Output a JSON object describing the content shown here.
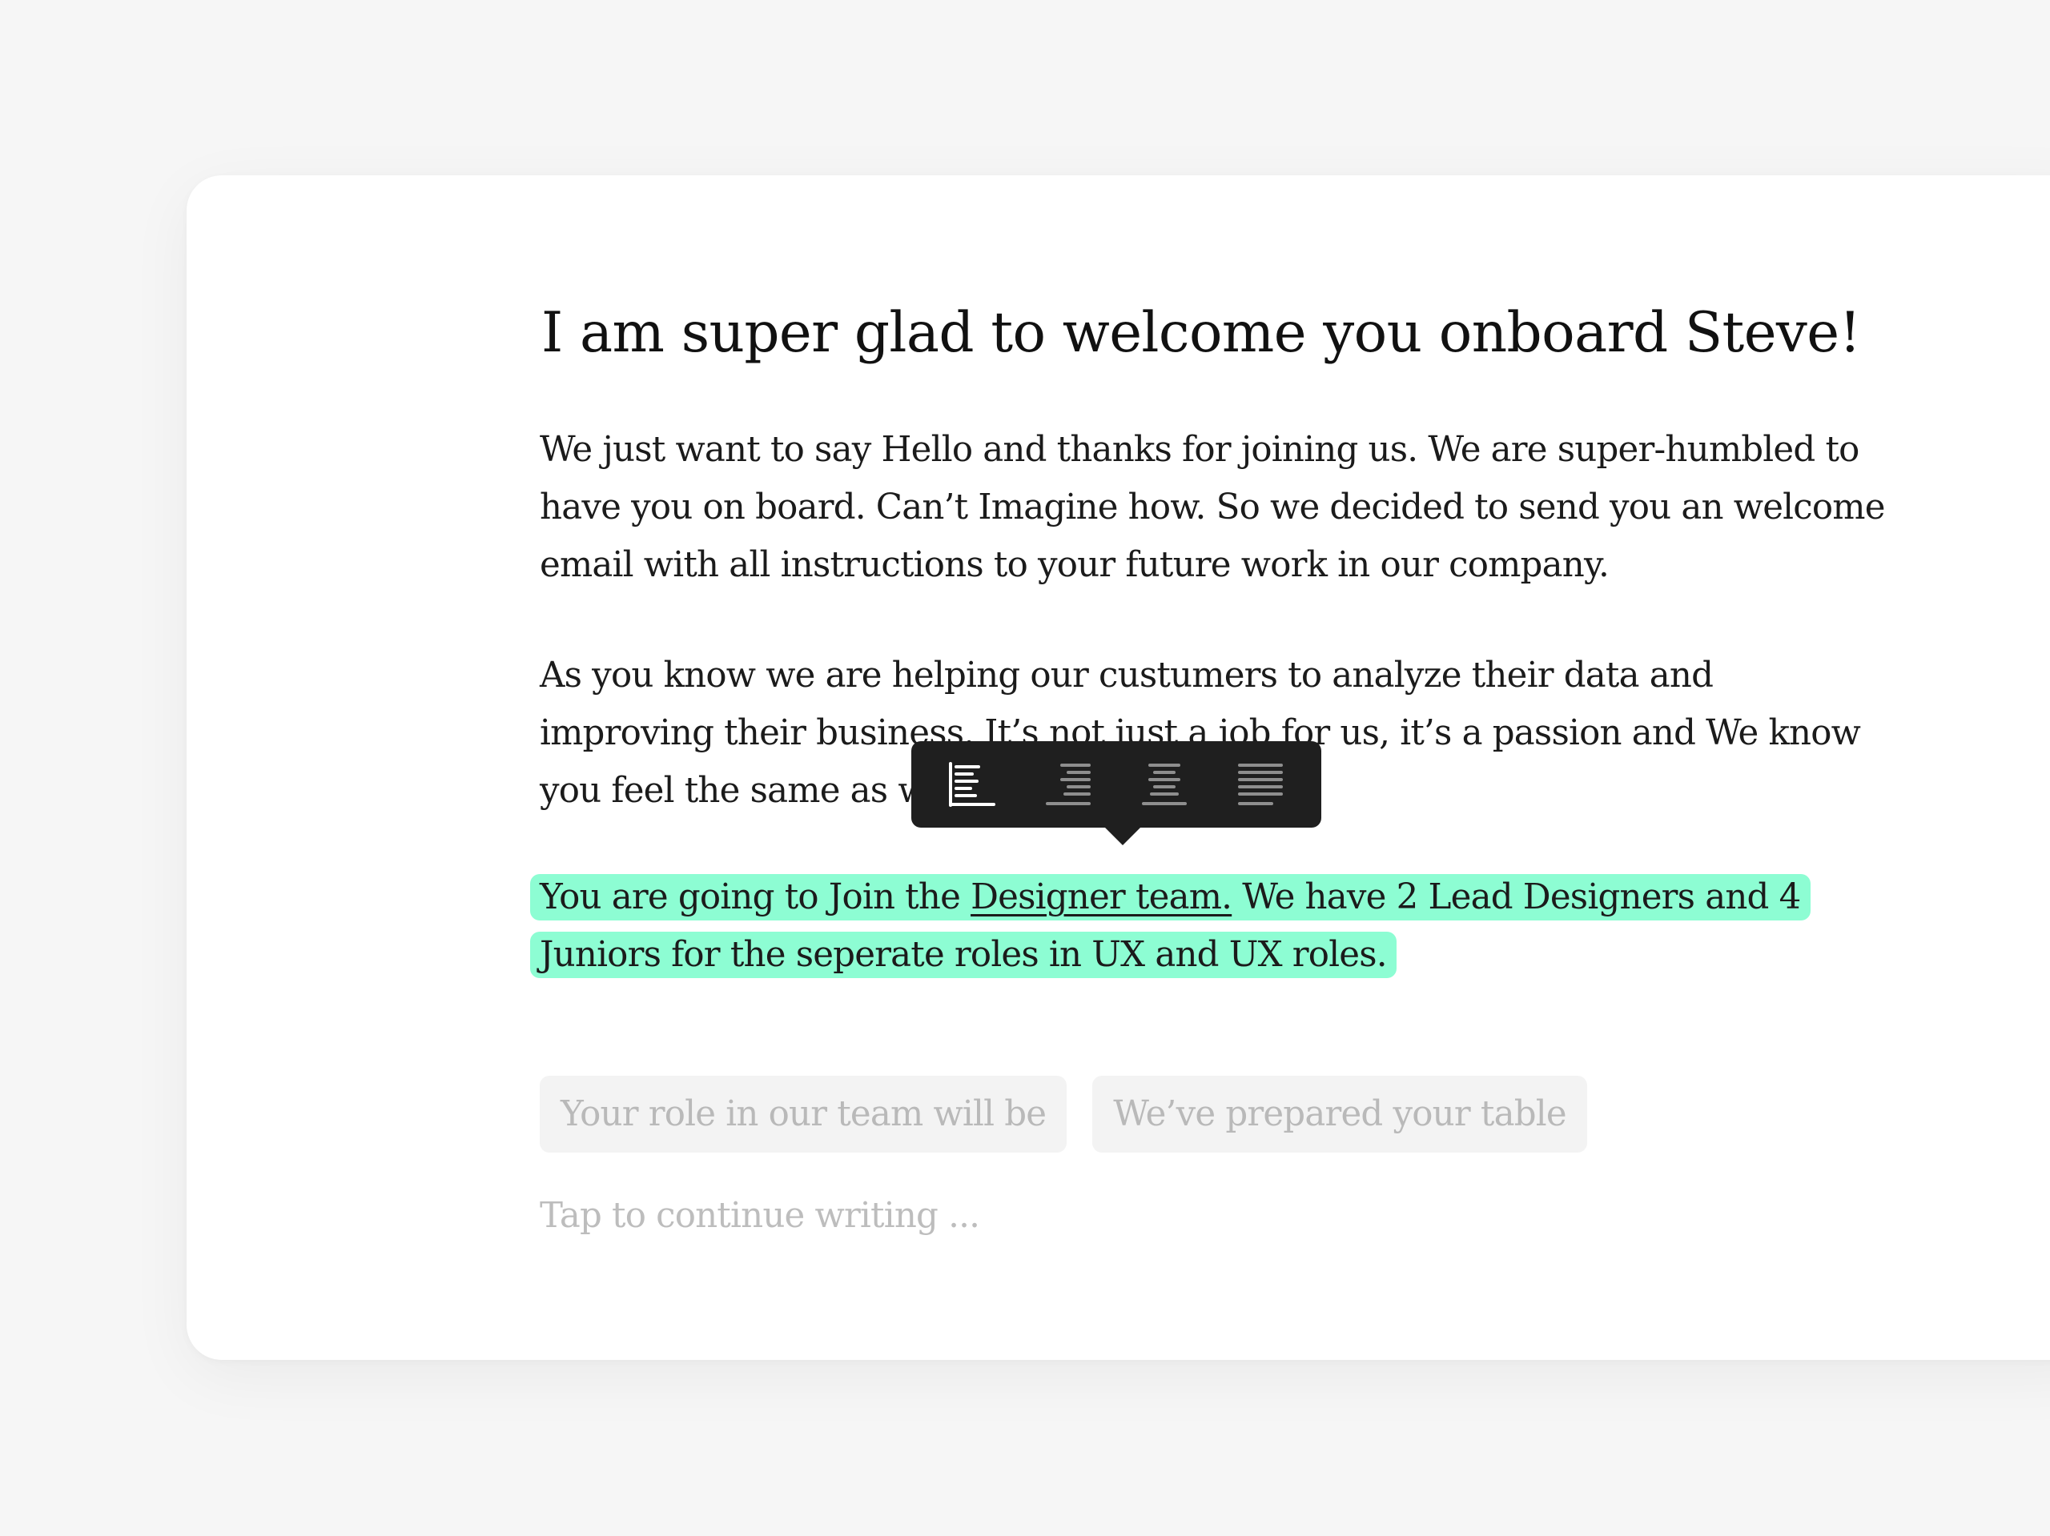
{
  "document": {
    "title": "I am super glad to welcome you onboard Steve!",
    "paragraph1": [
      "We just want to say Hello and thanks for joining us. We are super-humbled to",
      "have you on board. Can’t Imagine how. So we decided to send you an welcome",
      "email with all instructions to your future work in our company."
    ],
    "paragraph2": [
      "As you know we are helping our custumers to analyze their data and",
      "improving their business. It’s not just a job for us, it’s a passion and We know",
      "you feel the same as we do."
    ],
    "paragraph3": {
      "line1_before": "You are going to Join the ",
      "line1_link": "Designer team.",
      "line1_after": " We have 2 Lead Designers and 4",
      "line2": "Juniors for the seperate roles in UX and UX roles."
    },
    "highlight_color": "#8dfdd3"
  },
  "toolbar": {
    "buttons": [
      {
        "icon": "align-left-icon",
        "active": true
      },
      {
        "icon": "align-right-icon",
        "active": false
      },
      {
        "icon": "align-center-icon",
        "active": false
      },
      {
        "icon": "align-justify-icon",
        "active": false
      }
    ],
    "background": "#1f1f1f"
  },
  "suggestions": {
    "chip1": "Your role in our team will be",
    "chip2": "We’ve prepared your table"
  },
  "continue_placeholder": "Tap to continue writing ..."
}
